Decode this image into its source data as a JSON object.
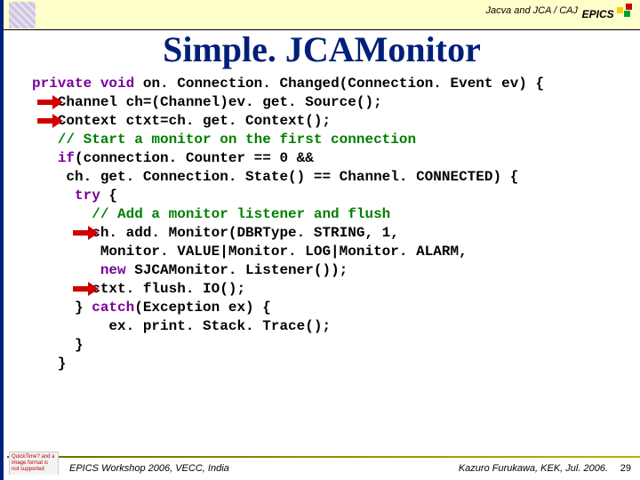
{
  "header": {
    "running_title": "Jacva and JCA / CAJ",
    "badge": "EPICS"
  },
  "title": "Simple. JCAMonitor",
  "code": {
    "l1a": "private",
    "l1b": " ",
    "l1c": "void",
    "l1d": " on. Connection. Changed(Connection. Event ev) {",
    "l2": "   Channel ch=(Channel)ev. get. Source();",
    "l3": "   Context ctxt=ch. get. Context();",
    "l4": "   // Start a monitor on the first connection",
    "l5a": "   ",
    "l5b": "if",
    "l5c": "(connection. Counter == 0 &&",
    "l6": "    ch. get. Connection. State() == Channel. CONNECTED) {",
    "l7a": "     ",
    "l7b": "try",
    "l7c": " {",
    "l8": "       // Add a monitor listener and flush",
    "l9": "       ch. add. Monitor(DBRType. STRING, 1,",
    "l10": "        Monitor. VALUE|Monitor. LOG|Monitor. ALARM,",
    "l11a": "        ",
    "l11b": "new",
    "l11c": " SJCAMonitor. Listener());",
    "l12": "       ctxt. flush. IO();",
    "l13a": "     } ",
    "l13b": "catch",
    "l13c": "(Exception ex) {",
    "l14": "         ex. print. Stack. Trace();",
    "l15": "     }",
    "l16": "   }"
  },
  "footer": {
    "left": "EPICS Workshop 2006, VECC, India",
    "right": "Kazuro Furukawa, KEK, Jul. 2006.",
    "page": "29",
    "broken": "QuickTime? and a image format is not supported"
  }
}
